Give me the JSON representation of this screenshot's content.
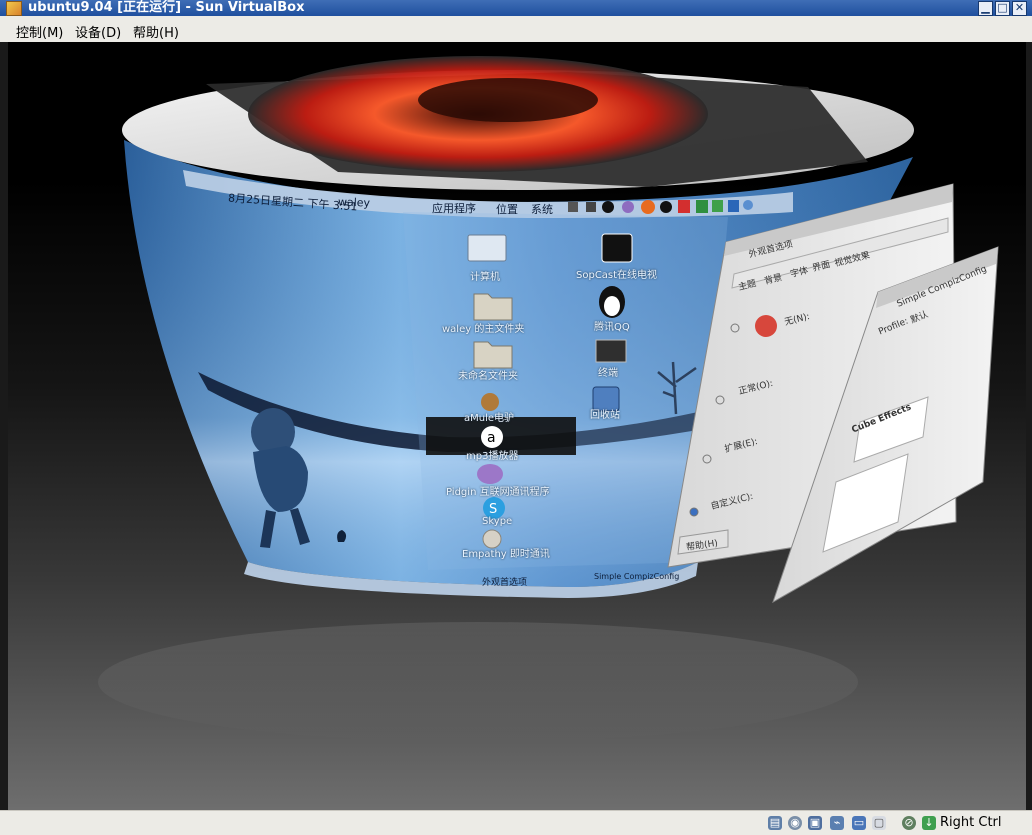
{
  "window": {
    "title": "ubuntu9.04 [正在运行] - Sun VirtualBox",
    "buttons": {
      "minimize": "▁",
      "maximize": "□",
      "close": "✕"
    }
  },
  "menubar": {
    "items": [
      {
        "label": "控制(M)"
      },
      {
        "label": "设备(D)"
      },
      {
        "label": "帮助(H)"
      }
    ]
  },
  "guest": {
    "top_panel": {
      "clock": "8月25日星期二 下午 3:51",
      "user": "waley",
      "menus": [
        "应用程序",
        "位置",
        "系统"
      ]
    },
    "desktop_icons": [
      {
        "label": "计算机",
        "icon": "computer-icon"
      },
      {
        "label": "SopCast在线电视",
        "icon": "tv-icon"
      },
      {
        "label": "waley 的主文件夹",
        "icon": "home-folder-icon"
      },
      {
        "label": "腾讯QQ",
        "icon": "qq-penguin-icon"
      },
      {
        "label": "未命名文件夹",
        "icon": "folder-icon"
      },
      {
        "label": "终端",
        "icon": "terminal-icon"
      },
      {
        "label": "aMule电驴",
        "icon": "amule-icon"
      },
      {
        "label": "回收站",
        "icon": "trash-icon"
      },
      {
        "label": "mp3播放器",
        "icon": "mp3-icon"
      },
      {
        "label": "Pidgin 互联网通讯程序",
        "icon": "pidgin-icon"
      },
      {
        "label": "Skype",
        "icon": "skype-icon"
      },
      {
        "label": "Empathy 即时通讯",
        "icon": "empathy-icon"
      }
    ],
    "bottom_taskbar": {
      "tasks": [
        "外观首选项",
        "Simple CompizConfig"
      ]
    },
    "dialog_appearance": {
      "title": "外观首选项",
      "tabs": [
        "主题",
        "背景",
        "字体",
        "界面",
        "视觉效果"
      ],
      "options": [
        {
          "label": "无(N):",
          "selected": false
        },
        {
          "label": "正常(O):",
          "selected": false
        },
        {
          "label": "扩展(E):",
          "selected": false
        },
        {
          "label": "自定义(C):",
          "selected": true
        }
      ],
      "help_button": "帮助(H)"
    },
    "dialog_compiz": {
      "title": "Simple CompizConfig",
      "profile_label": "Profile:",
      "profile_value": "默认",
      "section": "Cube Effects"
    }
  },
  "statusbar": {
    "icons": [
      "hdd-icon",
      "cd-icon",
      "network-icon",
      "usb-icon",
      "shared-folder-icon",
      "display-icon",
      "capture-icon",
      "mouse-integration-icon"
    ],
    "host_key": "Right Ctrl"
  },
  "colors": {
    "titlebar": "#2a5aa8",
    "menubar": "#ecebe6",
    "desktop_sky": "#3f7fbf",
    "panel": "#b8cce4"
  }
}
